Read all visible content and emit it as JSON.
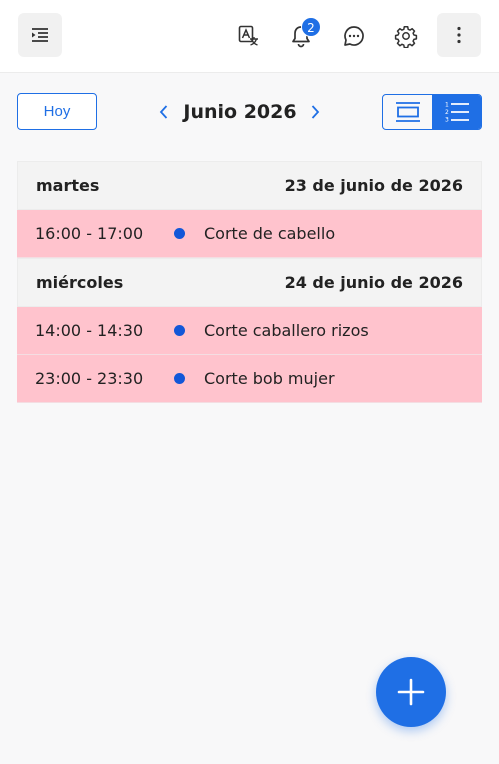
{
  "header": {
    "notifications_count": "2",
    "icons": [
      "menu-indent-icon",
      "translate-icon",
      "bell-icon",
      "chat-bubble-icon",
      "gear-icon",
      "more-vertical-icon"
    ]
  },
  "toolbar": {
    "today_label": "Hoy",
    "month_label": "Junio 2026",
    "views": [
      "schedule-view-icon",
      "list-view-icon"
    ],
    "active_view": "list"
  },
  "agenda": [
    {
      "weekday": "martes",
      "date": "23 de junio de 2026",
      "events": [
        {
          "time": "16:00 - 17:00",
          "title": "Corte de cabello"
        }
      ]
    },
    {
      "weekday": "miércoles",
      "date": "24 de junio de 2026",
      "events": [
        {
          "time": "14:00 - 14:30",
          "title": "Corte caballero rizos"
        },
        {
          "time": "23:00 - 23:30",
          "title": "Corte bob mujer"
        }
      ]
    }
  ],
  "colors": {
    "accent": "#1f6fe5",
    "event_bg": "#ffc3cd",
    "event_dot": "#1257d8",
    "day_header_bg": "#f3f3f3"
  }
}
